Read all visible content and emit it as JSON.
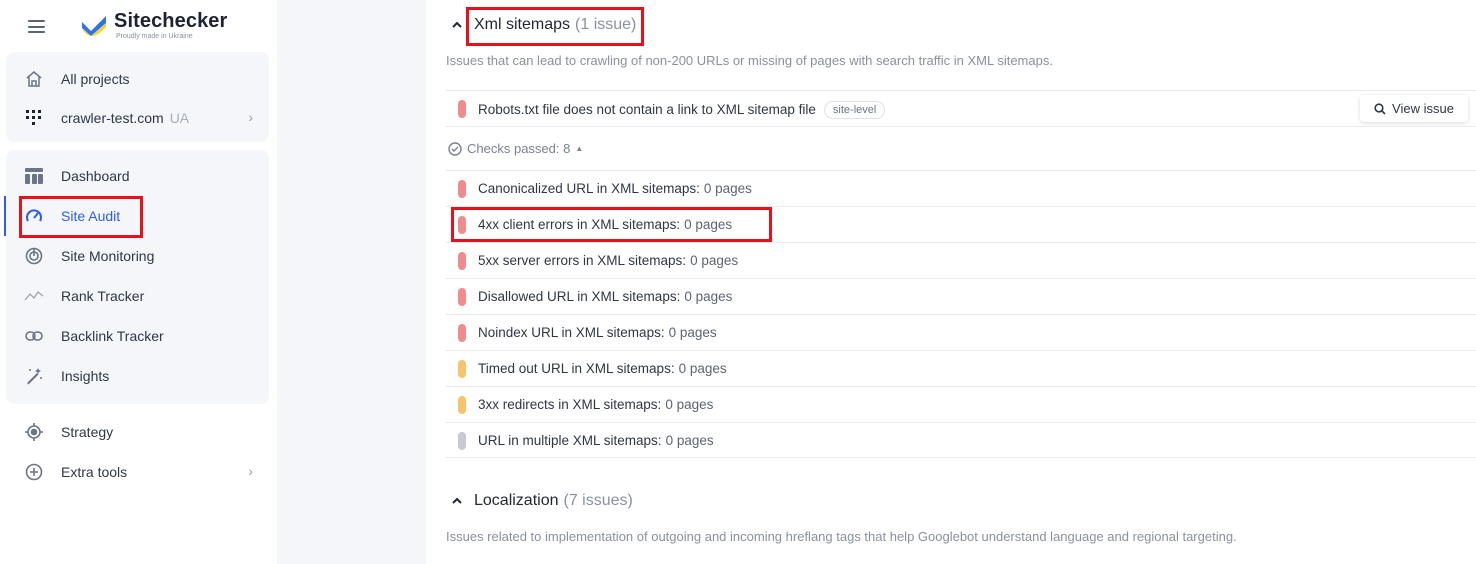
{
  "brand": {
    "name": "Sitechecker",
    "tagline": "Proudly made in Ukraine"
  },
  "sidebar": {
    "top": [
      {
        "label": "All projects",
        "icon": "home-icon"
      },
      {
        "label": "crawler-test.com",
        "sub": "UA",
        "icon": "project-favicon-icon"
      }
    ],
    "items": [
      {
        "label": "Dashboard",
        "icon": "dashboard-icon"
      },
      {
        "label": "Site Audit",
        "icon": "speedometer-icon",
        "active": true
      },
      {
        "label": "Site Monitoring",
        "icon": "monitoring-icon"
      },
      {
        "label": "Rank Tracker",
        "icon": "rank-tracker-icon"
      },
      {
        "label": "Backlink Tracker",
        "icon": "link-icon"
      },
      {
        "label": "Insights",
        "icon": "magic-wand-icon"
      }
    ],
    "bottom": [
      {
        "label": "Strategy",
        "icon": "target-icon"
      },
      {
        "label": "Extra tools",
        "icon": "plus-circle-icon"
      }
    ]
  },
  "sections": [
    {
      "title": "Xml sitemaps",
      "count": "(1 issue)",
      "description": "Issues that can lead to crawling of non-200 URLs or missing of pages with search traffic in XML sitemaps."
    },
    {
      "title": "Localization",
      "count": "(7 issues)",
      "description": "Issues related to implementation of outgoing and incoming hreflang tags that help Googlebot understand language and regional targeting."
    }
  ],
  "issue": {
    "label": "Robots.txt file does not contain a link to XML sitemap file",
    "tag": "site-level",
    "button": "View issue"
  },
  "checks_passed": "Checks passed: 8",
  "checks": [
    {
      "label": "Canonicalized URL in XML sitemaps:",
      "pages": "0 pages",
      "severity": "critical"
    },
    {
      "label": "4xx client errors in XML sitemaps:",
      "pages": "0 pages",
      "severity": "critical"
    },
    {
      "label": "5xx server errors in XML sitemaps:",
      "pages": "0 pages",
      "severity": "critical"
    },
    {
      "label": "Disallowed URL in XML sitemaps:",
      "pages": "0 pages",
      "severity": "critical"
    },
    {
      "label": "Noindex URL in XML sitemaps:",
      "pages": "0 pages",
      "severity": "critical"
    },
    {
      "label": "Timed out URL in XML sitemaps:",
      "pages": "0 pages",
      "severity": "warning"
    },
    {
      "label": "3xx redirects in XML sitemaps:",
      "pages": "0 pages",
      "severity": "warning"
    },
    {
      "label": "URL in multiple XML sitemaps:",
      "pages": "0 pages",
      "severity": "notice"
    }
  ],
  "colors": {
    "accent": "#2c5ee8",
    "critical": "#f28b8b",
    "warning": "#f7c46c",
    "notice": "#c5cad3",
    "highlight": "#e8101b"
  }
}
